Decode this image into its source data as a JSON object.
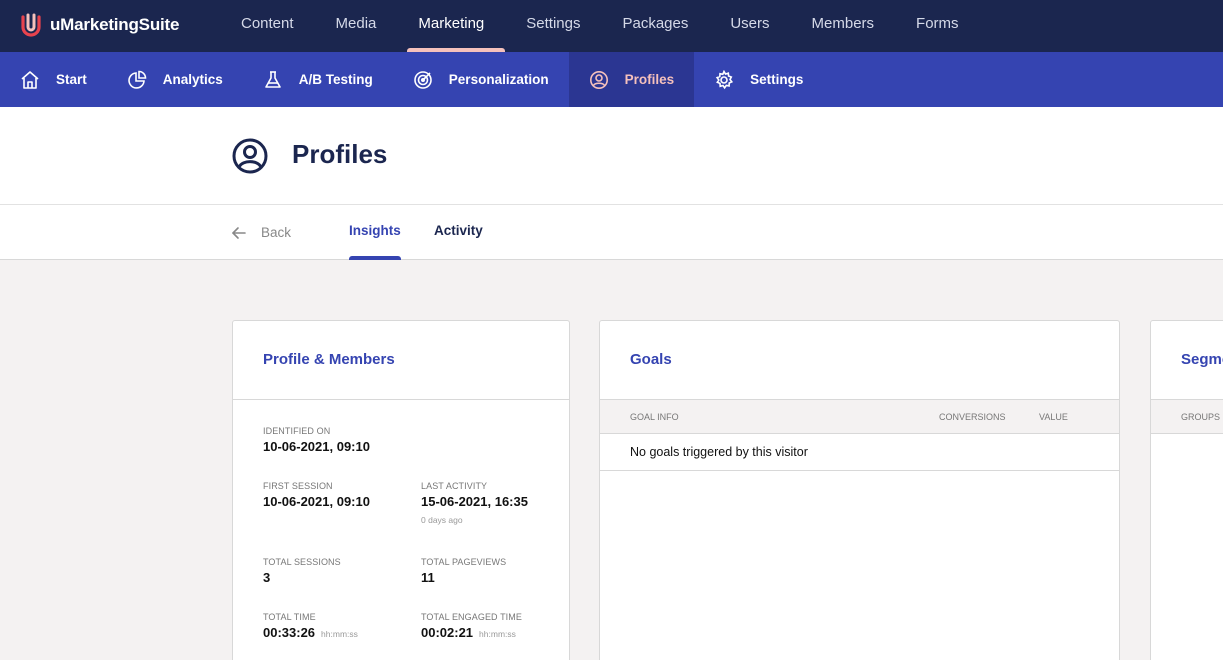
{
  "app": {
    "name": "uMarketingSuite"
  },
  "top_nav": [
    "Content",
    "Media",
    "Marketing",
    "Settings",
    "Packages",
    "Users",
    "Members",
    "Forms"
  ],
  "sub_nav": [
    "Start",
    "Analytics",
    "A/B Testing",
    "Personalization",
    "Profiles",
    "Settings"
  ],
  "page": {
    "title": "Profiles"
  },
  "tabs": {
    "back": "Back",
    "insights": "Insights",
    "activity": "Activity"
  },
  "profile_card": {
    "title": "Profile & Members",
    "identified_on": {
      "label": "IDENTIFIED ON",
      "value": "10-06-2021, 09:10"
    },
    "first_session": {
      "label": "FIRST SESSION",
      "value": "10-06-2021, 09:10"
    },
    "last_activity": {
      "label": "LAST ACTIVITY",
      "value": "15-06-2021, 16:35",
      "sub": "0 days ago"
    },
    "total_sessions": {
      "label": "TOTAL SESSIONS",
      "value": "3"
    },
    "total_pageviews": {
      "label": "TOTAL PAGEVIEWS",
      "value": "11"
    },
    "total_time": {
      "label": "TOTAL TIME",
      "value": "00:33:26",
      "unit": "hh:mm:ss"
    },
    "total_engaged_time": {
      "label": "TOTAL ENGAGED TIME",
      "value": "00:02:21",
      "unit": "hh:mm:ss"
    }
  },
  "goals_card": {
    "title": "Goals",
    "columns": [
      "GOAL INFO",
      "CONVERSIONS",
      "VALUE"
    ],
    "empty_message": "No goals triggered by this visitor"
  },
  "segments_card": {
    "title": "Segme",
    "columns": [
      "GROUPS"
    ]
  },
  "colors": {
    "topbar": "#1b264f",
    "subnav": "#3544b1",
    "subnav_active": "#2b3692",
    "accent_pink": "#f5c1bc",
    "link_blue": "#3544b1"
  }
}
